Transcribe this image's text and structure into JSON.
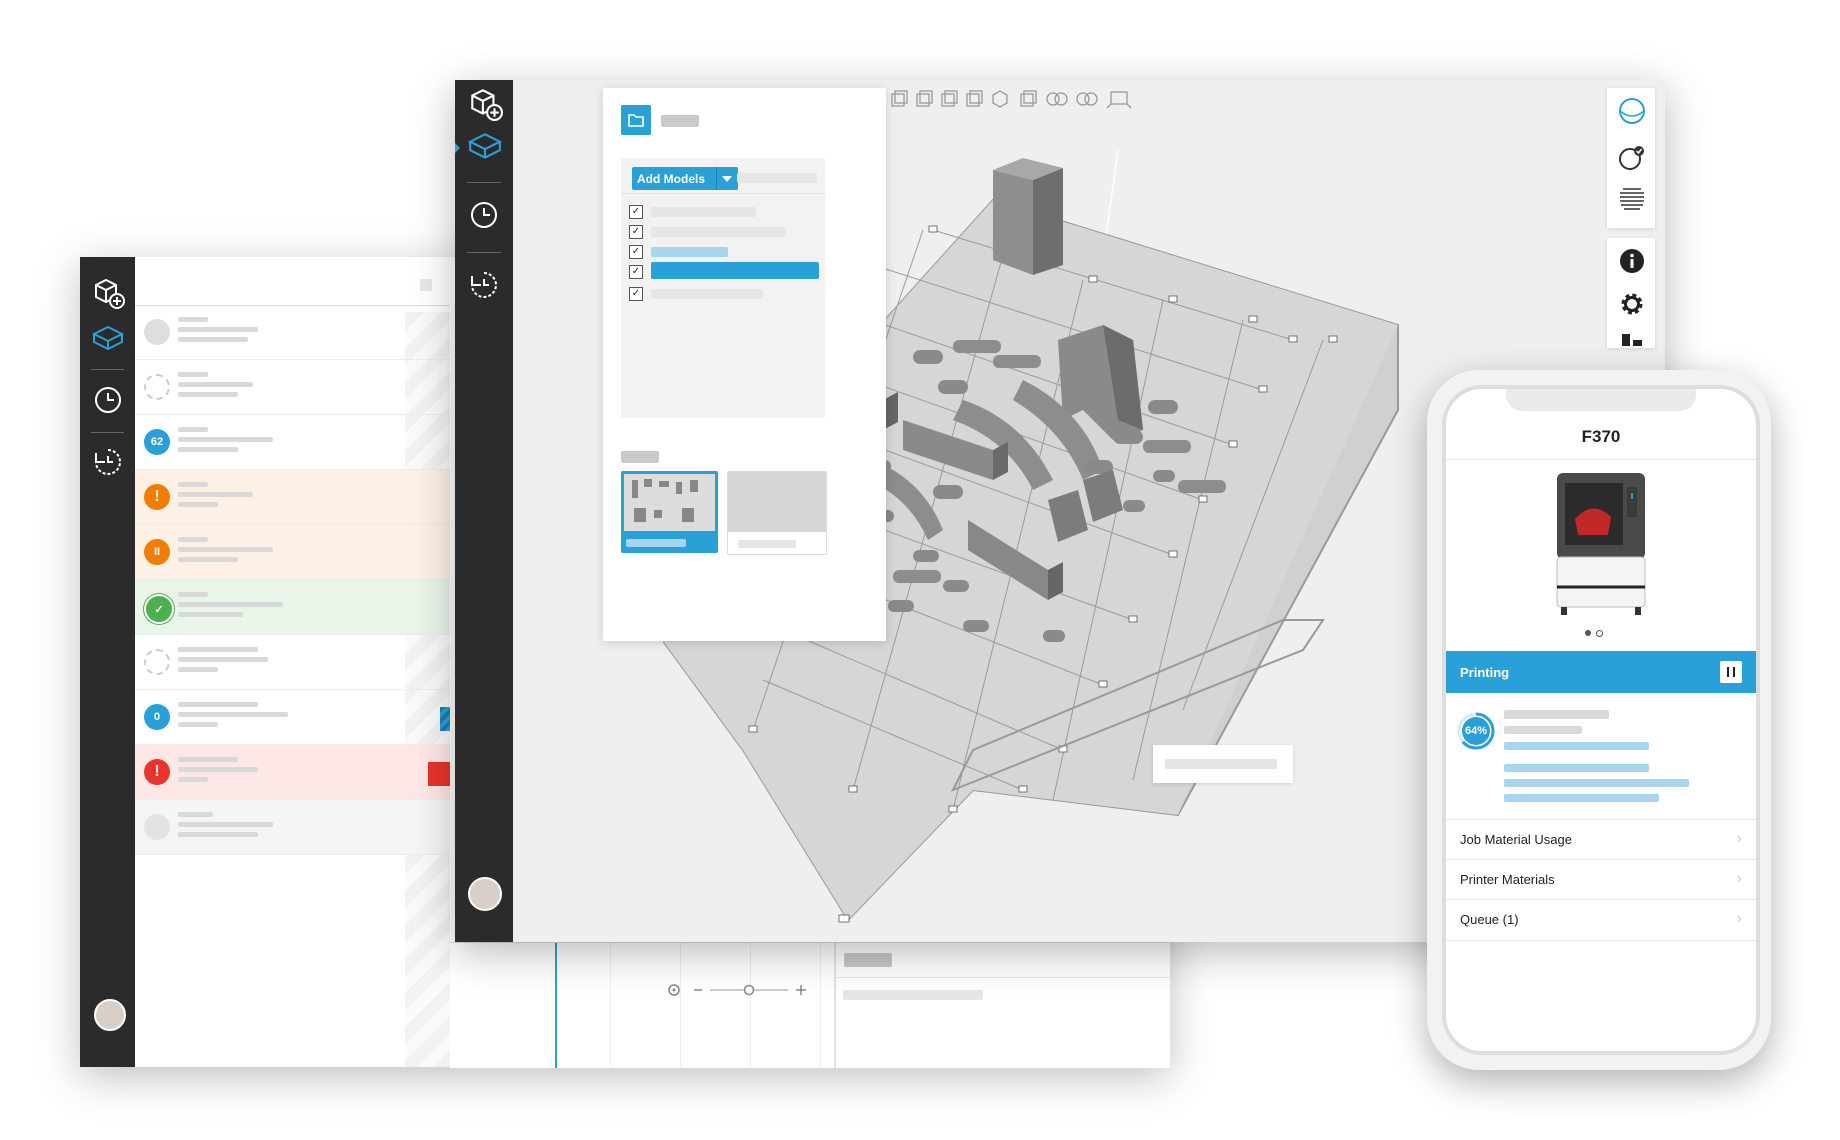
{
  "front_window": {
    "add_models_label": "Add Models"
  },
  "back_window": {
    "rows": [
      {
        "status": "idle-grey",
        "badge": ""
      },
      {
        "status": "idle-dashed",
        "badge": ""
      },
      {
        "status": "queued-blue",
        "badge": "62"
      },
      {
        "status": "warning-orange",
        "badge": "!"
      },
      {
        "status": "paused-orange",
        "badge": "II"
      },
      {
        "status": "complete-green",
        "badge": "✓"
      },
      {
        "status": "idle-dashed",
        "badge": ""
      },
      {
        "status": "queued-blue",
        "badge": "0"
      },
      {
        "status": "error-red",
        "badge": "!"
      },
      {
        "status": "offline-grey",
        "badge": ""
      }
    ]
  },
  "phone": {
    "printer_name": "F370",
    "status_label": "Printing",
    "progress_label": "64%",
    "progress": 0.64,
    "menu": [
      {
        "label": "Job Material Usage"
      },
      {
        "label": "Printer Materials"
      },
      {
        "label": "Queue (1)"
      }
    ]
  },
  "colors": {
    "accent": "#2aa0d8",
    "rail": "#2b2b2b",
    "warning": "#f07d00",
    "error": "#e8342a",
    "success": "#4caf50"
  }
}
